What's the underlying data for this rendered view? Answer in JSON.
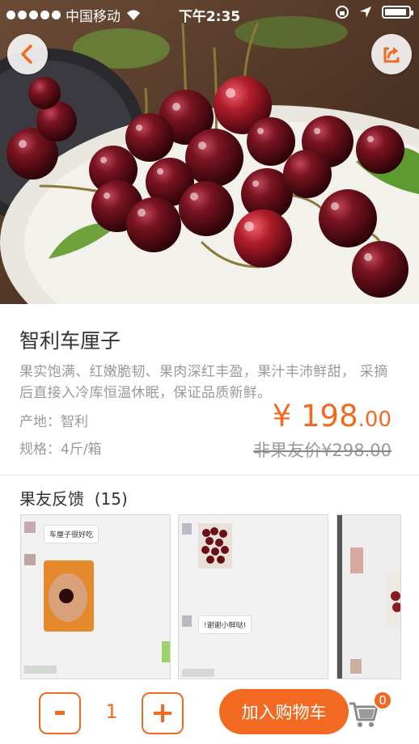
{
  "status_bar": {
    "carrier": "中国移动",
    "time": "下午2:35"
  },
  "product": {
    "title": "智利车厘子",
    "description": "果实饱满、红嫩脆韧、果肉深红丰盈，果汁丰沛鲜甜， 采摘后直接入冷库恒温休眠，保证品质新鲜。",
    "origin": "产地：智利",
    "spec": "规格：4斤/箱",
    "price_symbol": "¥ ",
    "price_integer": "198",
    "price_decimal": ".00",
    "original_price": "非果友价¥298.00"
  },
  "feedback": {
    "title": "果友反馈",
    "count": "(15)",
    "review_1_message": "车厘子很好吃",
    "review_2_message": "!谢谢小鲜哒!"
  },
  "bottom_bar": {
    "minus_label": "-",
    "plus_label": "+",
    "quantity": "1",
    "add_to_cart_label": "加入购物车",
    "cart_count": "0"
  },
  "colors": {
    "accent": "#f26a22",
    "price": "#f26a22",
    "muted_text": "#9a9a9a"
  },
  "icons": [
    "back-icon",
    "share-icon",
    "cart-icon",
    "wifi-icon",
    "location-icon",
    "battery-icon"
  ]
}
